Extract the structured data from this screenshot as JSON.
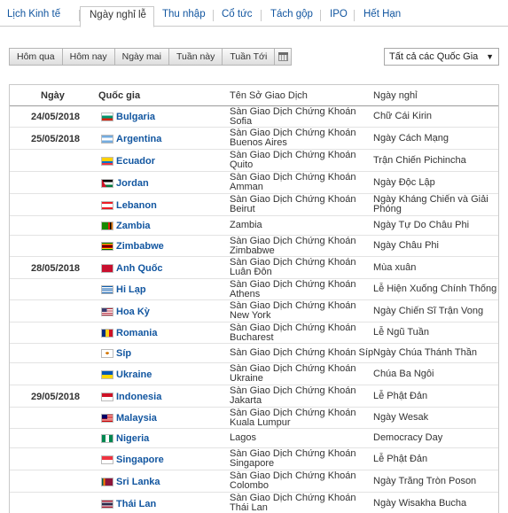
{
  "tabs": [
    {
      "label": "Lịch Kinh tế"
    },
    {
      "label": "Ngày nghỉ lễ"
    },
    {
      "label": "Thu nhập"
    },
    {
      "label": "Cổ tức"
    },
    {
      "label": "Tách gộp"
    },
    {
      "label": "IPO"
    },
    {
      "label": "Hết Hạn"
    }
  ],
  "day_buttons": [
    "Hôm qua",
    "Hôm nay",
    "Ngày mai",
    "Tuần này",
    "Tuần Tới"
  ],
  "country_filter": {
    "selected": "Tất cả các Quốc Gia",
    "caret": "▼"
  },
  "table": {
    "headers": {
      "date": "Ngày",
      "country": "Quốc gia",
      "exchange": "Tên Sở Giao Dịch",
      "holiday": "Ngày nghỉ"
    },
    "rows": [
      {
        "date": "24/05/2018",
        "country": "Bulgaria",
        "flag": "bulgaria-flag-icon",
        "exchange": [
          "Sàn Giao Dịch Chứng Khoán",
          "Sofia"
        ],
        "holiday": [
          "Chữ Cái Kirin"
        ]
      },
      {
        "date": "25/05/2018",
        "country": "Argentina",
        "flag": "argentina-flag-icon",
        "exchange": [
          "Sàn Giao Dịch Chứng Khoán",
          "Buenos Aires"
        ],
        "holiday": [
          "Ngày Cách Mạng"
        ]
      },
      {
        "date": "",
        "country": "Ecuador",
        "flag": "ecuador-flag-icon",
        "exchange": [
          "Sàn Giao Dịch Chứng Khoán",
          "Quito"
        ],
        "holiday": [
          "Trận Chiến Pichincha"
        ]
      },
      {
        "date": "",
        "country": "Jordan",
        "flag": "jordan-flag-icon",
        "exchange": [
          "Sàn Giao Dịch Chứng Khoán",
          "Amman"
        ],
        "holiday": [
          "Ngày Độc Lập"
        ]
      },
      {
        "date": "",
        "country": "Lebanon",
        "flag": "lebanon-flag-icon",
        "exchange": [
          "Sàn Giao Dịch Chứng Khoán",
          "Beirut"
        ],
        "holiday": [
          "Ngày Kháng Chiến và Giải",
          "Phóng"
        ]
      },
      {
        "date": "",
        "country": "Zambia",
        "flag": "zambia-flag-icon",
        "exchange": [
          "Zambia"
        ],
        "holiday": [
          "Ngày Tự Do Châu Phi"
        ]
      },
      {
        "date": "",
        "country": "Zimbabwe",
        "flag": "zimbabwe-flag-icon",
        "exchange": [
          "Sàn Giao Dịch Chứng Khoán",
          "Zimbabwe"
        ],
        "holiday": [
          "Ngày Châu Phi"
        ]
      },
      {
        "date": "28/05/2018",
        "country": "Anh Quốc",
        "flag": "uk-flag-icon",
        "exchange": [
          "Sàn Giao Dịch Chứng Khoán",
          "Luân Đôn"
        ],
        "holiday": [
          "Mùa xuân"
        ]
      },
      {
        "date": "",
        "country": "Hi Lạp",
        "flag": "greece-flag-icon",
        "exchange": [
          "Sàn Giao Dịch Chứng Khoán",
          "Athens"
        ],
        "holiday": [
          "Lễ Hiện Xuống Chính Thống"
        ]
      },
      {
        "date": "",
        "country": "Hoa Kỳ",
        "flag": "usa-flag-icon",
        "exchange": [
          "Sàn Giao Dịch Chứng Khoán",
          "New York"
        ],
        "holiday": [
          "Ngày Chiến Sĩ Trận Vong"
        ]
      },
      {
        "date": "",
        "country": "Romania",
        "flag": "romania-flag-icon",
        "exchange": [
          "Sàn Giao Dịch Chứng Khoán",
          "Bucharest"
        ],
        "holiday": [
          "Lễ Ngũ Tuần"
        ]
      },
      {
        "date": "",
        "country": "Síp",
        "flag": "cyprus-flag-icon",
        "exchange": [
          "Sàn Giao Dịch Chứng Khoán Síp"
        ],
        "holiday": [
          "Ngày Chúa Thánh Thần"
        ]
      },
      {
        "date": "",
        "country": "Ukraine",
        "flag": "ukraine-flag-icon",
        "exchange": [
          "Sàn Giao Dịch Chứng Khoán",
          "Ukraine"
        ],
        "holiday": [
          "Chúa Ba Ngôi"
        ]
      },
      {
        "date": "29/05/2018",
        "country": "Indonesia",
        "flag": "indonesia-flag-icon",
        "exchange": [
          "Sàn Giao Dịch Chứng Khoán",
          "Jakarta"
        ],
        "holiday": [
          "Lễ Phật Đản"
        ]
      },
      {
        "date": "",
        "country": "Malaysia",
        "flag": "malaysia-flag-icon",
        "exchange": [
          "Sàn Giao Dịch Chứng Khoán",
          "Kuala Lumpur"
        ],
        "holiday": [
          "Ngày Wesak"
        ]
      },
      {
        "date": "",
        "country": "Nigeria",
        "flag": "nigeria-flag-icon",
        "exchange": [
          "Lagos"
        ],
        "holiday": [
          "Democracy Day"
        ]
      },
      {
        "date": "",
        "country": "Singapore",
        "flag": "singapore-flag-icon",
        "exchange": [
          "Sàn Giao Dịch Chứng Khoán",
          "Singapore"
        ],
        "holiday": [
          "Lễ Phật Đản"
        ]
      },
      {
        "date": "",
        "country": "Sri Lanka",
        "flag": "sri-lanka-flag-icon",
        "exchange": [
          "Sàn Giao Dịch Chứng Khoán",
          "Colombo"
        ],
        "holiday": [
          "Ngày Trăng Tròn Poson"
        ]
      },
      {
        "date": "",
        "country": "Thái Lan",
        "flag": "thailand-flag-icon",
        "exchange": [
          "Sàn Giao Dịch Chứng Khoán",
          "Thái Lan"
        ],
        "holiday": [
          "Ngày Wisakha Bucha"
        ]
      }
    ]
  },
  "colors": {
    "link": "#1256a0",
    "border": "#c9c9c9"
  }
}
